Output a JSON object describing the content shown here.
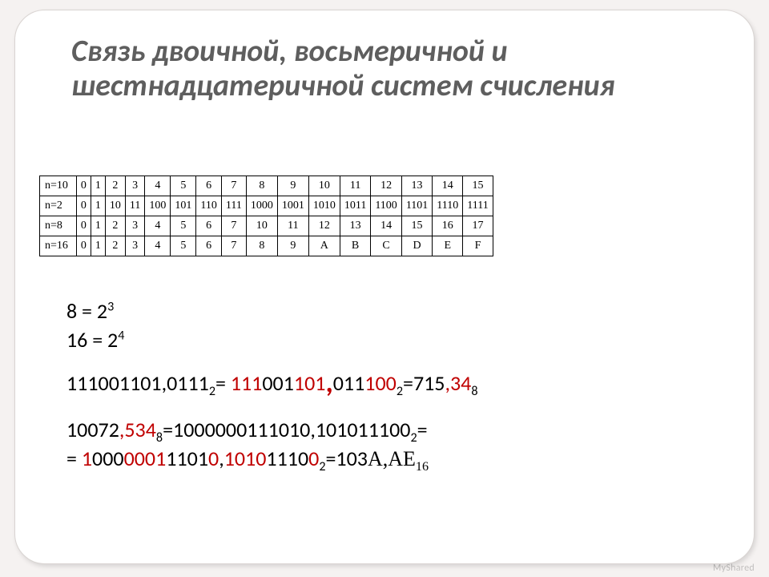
{
  "title": "Связь двоичной, восьмеричной и шестнадцатеричной систем счисления",
  "table": {
    "rows": [
      {
        "label": "n=10",
        "cells": [
          "0",
          "1",
          "2",
          "3",
          "4",
          "5",
          "6",
          "7",
          "8",
          "9",
          "10",
          "11",
          "12",
          "13",
          "14",
          "15"
        ]
      },
      {
        "label": "n=2",
        "cells": [
          "0",
          "1",
          "10",
          "11",
          "100",
          "101",
          "110",
          "111",
          "1000",
          "1001",
          "1010",
          "1011",
          "1100",
          "1101",
          "1110",
          "1111"
        ]
      },
      {
        "label": "n=8",
        "cells": [
          "0",
          "1",
          "2",
          "3",
          "4",
          "5",
          "6",
          "7",
          "10",
          "11",
          "12",
          "13",
          "14",
          "15",
          "16",
          "17"
        ]
      },
      {
        "label": "n=16",
        "cells": [
          "0",
          "1",
          "2",
          "3",
          "4",
          "5",
          "6",
          "7",
          "8",
          "9",
          "A",
          "B",
          "C",
          "D",
          "E",
          "F"
        ]
      }
    ]
  },
  "eq1": {
    "a": "8 = 2",
    "p": "3"
  },
  "eq2": {
    "a": "16 = 2",
    "p": "4"
  },
  "line3": {
    "a": "111001101,0111",
    "a_sub": "2",
    "eq": "= ",
    "b1": "111",
    "b2": "001",
    "b3": "101",
    "c1": "011",
    "c2": "100",
    "c_sub": "2",
    "eq2": "=715",
    "d": ",34",
    "d_sub": "8"
  },
  "line4": {
    "a": "10072",
    "b": ",534",
    "b_sub": "8",
    "eq": "=1000000111010,101011100",
    "eq_sub": "2",
    "tail": "="
  },
  "line5": {
    "lead": "= ",
    "g": [
      {
        "t": "1",
        "r": true
      },
      {
        "t": "000",
        "r": false
      },
      {
        "t": "0001",
        "r": true
      },
      {
        "t": "1101",
        "r": false
      },
      {
        "t": "0",
        "r": true
      },
      {
        "t": ",",
        "r": false
      },
      {
        "t": "1010",
        "r": true
      },
      {
        "t": "1110",
        "r": false
      },
      {
        "t": "0",
        "r": true
      }
    ],
    "g_sub": "2",
    "res_a": "=103",
    "res_b": "A,AE",
    "res_sub": "16"
  },
  "watermark": "MyShared"
}
